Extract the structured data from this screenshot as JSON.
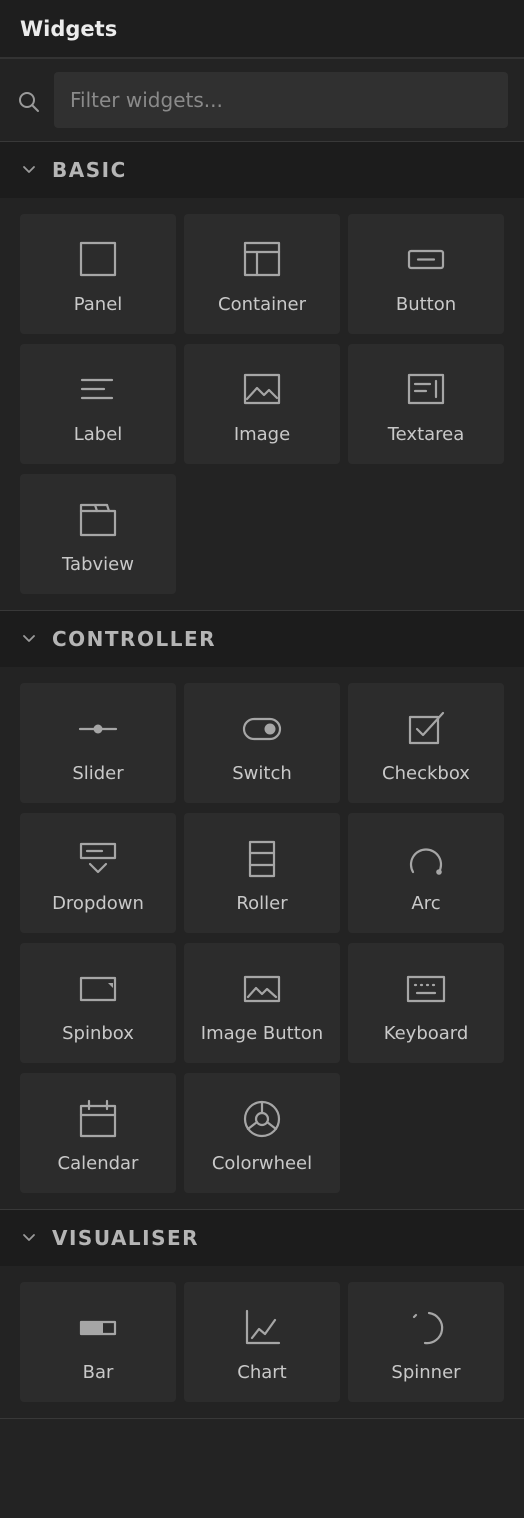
{
  "header": {
    "title": "Widgets"
  },
  "search": {
    "placeholder": "Filter widgets..."
  },
  "sections": [
    {
      "title": "BASIC",
      "items": [
        {
          "label": "Panel",
          "icon": "panel-icon"
        },
        {
          "label": "Container",
          "icon": "container-icon"
        },
        {
          "label": "Button",
          "icon": "button-icon"
        },
        {
          "label": "Label",
          "icon": "label-icon"
        },
        {
          "label": "Image",
          "icon": "image-icon"
        },
        {
          "label": "Textarea",
          "icon": "textarea-icon"
        },
        {
          "label": "Tabview",
          "icon": "tabview-icon"
        }
      ]
    },
    {
      "title": "CONTROLLER",
      "items": [
        {
          "label": "Slider",
          "icon": "slider-icon"
        },
        {
          "label": "Switch",
          "icon": "switch-icon"
        },
        {
          "label": "Checkbox",
          "icon": "checkbox-icon"
        },
        {
          "label": "Dropdown",
          "icon": "dropdown-icon"
        },
        {
          "label": "Roller",
          "icon": "roller-icon"
        },
        {
          "label": "Arc",
          "icon": "arc-icon"
        },
        {
          "label": "Spinbox",
          "icon": "spinbox-icon"
        },
        {
          "label": "Image Button",
          "icon": "image-button-icon"
        },
        {
          "label": "Keyboard",
          "icon": "keyboard-icon"
        },
        {
          "label": "Calendar",
          "icon": "calendar-icon"
        },
        {
          "label": "Colorwheel",
          "icon": "colorwheel-icon"
        }
      ]
    },
    {
      "title": "VISUALISER",
      "items": [
        {
          "label": "Bar",
          "icon": "bar-icon"
        },
        {
          "label": "Chart",
          "icon": "chart-icon"
        },
        {
          "label": "Spinner",
          "icon": "spinner-icon"
        }
      ]
    }
  ]
}
